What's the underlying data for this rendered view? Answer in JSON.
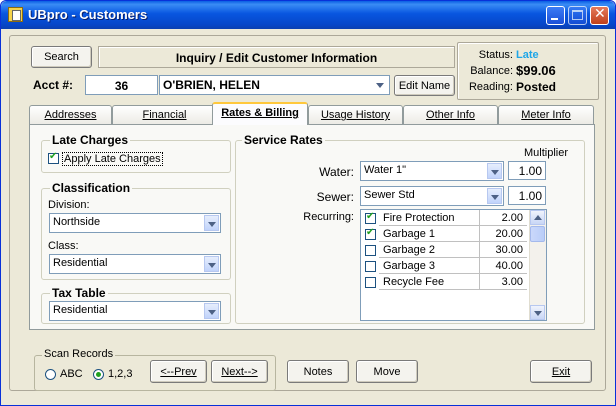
{
  "window": {
    "title": "UBpro - Customers"
  },
  "header": {
    "search_label": "Search",
    "heading": "Inquiry / Edit Customer Information",
    "acct_label": "Acct #:",
    "acct_value": "36",
    "customer_name": "O'BRIEN, HELEN",
    "edit_name_label": "Edit Name"
  },
  "status_panel": {
    "status_label": "Status:",
    "status_value": "Late",
    "balance_label": "Balance:",
    "balance_value": "$99.06",
    "reading_label": "Reading:",
    "reading_value": "Posted",
    "status_color": "#1ea6e8"
  },
  "tabs": [
    {
      "label": "Addresses"
    },
    {
      "label": "Financial"
    },
    {
      "label": "Rates & Billing"
    },
    {
      "label": "Usage History"
    },
    {
      "label": "Other Info"
    },
    {
      "label": "Meter Info"
    }
  ],
  "late_charges": {
    "title": "Late Charges",
    "apply_label": "Apply Late Charges",
    "apply_checked": true
  },
  "classification": {
    "title": "Classification",
    "division_label": "Division:",
    "division_value": "Northside",
    "class_label": "Class:",
    "class_value": "Residential"
  },
  "tax_table": {
    "title": "Tax Table",
    "value": "Residential"
  },
  "service_rates": {
    "title": "Service Rates",
    "multiplier_label": "Multiplier",
    "water_label": "Water:",
    "water_value": "Water 1\"",
    "water_multiplier": "1.00",
    "sewer_label": "Sewer:",
    "sewer_value": "Sewer Std",
    "sewer_multiplier": "1.00",
    "recurring_label": "Recurring:",
    "recurring": [
      {
        "name": "Fire Protection",
        "amount": "2.00",
        "checked": true
      },
      {
        "name": "Garbage 1",
        "amount": "20.00",
        "checked": true
      },
      {
        "name": "Garbage 2",
        "amount": "30.00",
        "checked": false
      },
      {
        "name": "Garbage 3",
        "amount": "40.00",
        "checked": false
      },
      {
        "name": "Recycle Fee",
        "amount": "3.00",
        "checked": false
      }
    ]
  },
  "scan_records": {
    "title": "Scan Records",
    "abc_label": "ABC",
    "num_label": "1,2,3",
    "selected": "1,2,3",
    "prev_label": "<--Prev",
    "next_label": "Next-->"
  },
  "footer": {
    "notes_label": "Notes",
    "move_label": "Move",
    "exit_label": "Exit"
  }
}
